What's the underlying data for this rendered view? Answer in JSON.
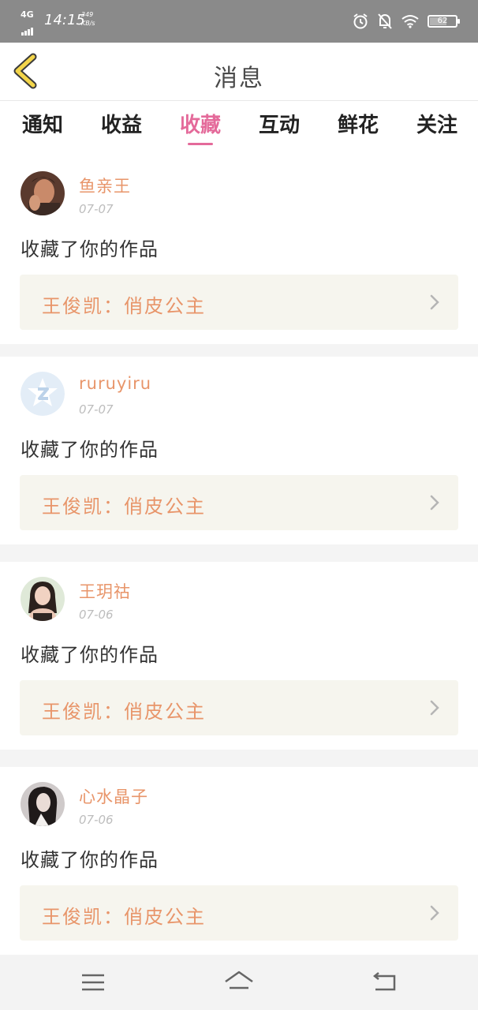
{
  "status_bar": {
    "network": "4G",
    "time": "14:15",
    "speed_value": "349",
    "speed_unit": "KB/s",
    "battery": "62"
  },
  "header": {
    "title": "消息",
    "back_icon": "chevron-left-icon"
  },
  "tabs": [
    {
      "label": "通知",
      "active": false
    },
    {
      "label": "收益",
      "active": false
    },
    {
      "label": "收藏",
      "active": true
    },
    {
      "label": "互动",
      "active": false
    },
    {
      "label": "鲜花",
      "active": false
    },
    {
      "label": "关注",
      "active": false
    }
  ],
  "notifications": [
    {
      "name": "鱼亲王",
      "date": "07-07",
      "action": "收藏了你的作品",
      "work": "王俊凯：俏皮公主",
      "avatar": "avatar-1"
    },
    {
      "name": "ruruyiru",
      "date": "07-07",
      "action": "收藏了你的作品",
      "work": "王俊凯：俏皮公主",
      "avatar": "qq-default-avatar"
    },
    {
      "name": "王玥祜",
      "date": "07-06",
      "action": "收藏了你的作品",
      "work": "王俊凯：俏皮公主",
      "avatar": "avatar-3"
    },
    {
      "name": "心水晶子",
      "date": "07-06",
      "action": "收藏了你的作品",
      "work": "王俊凯：俏皮公主",
      "avatar": "avatar-4"
    }
  ],
  "nav": {
    "menu_icon": "menu-icon",
    "home_icon": "home-icon",
    "back_icon": "back-icon"
  },
  "colors": {
    "accent": "#e46a9a",
    "orange_text": "#e8956a",
    "status_bar": "#8a8a8a",
    "link_bg": "#f6f5ee"
  }
}
